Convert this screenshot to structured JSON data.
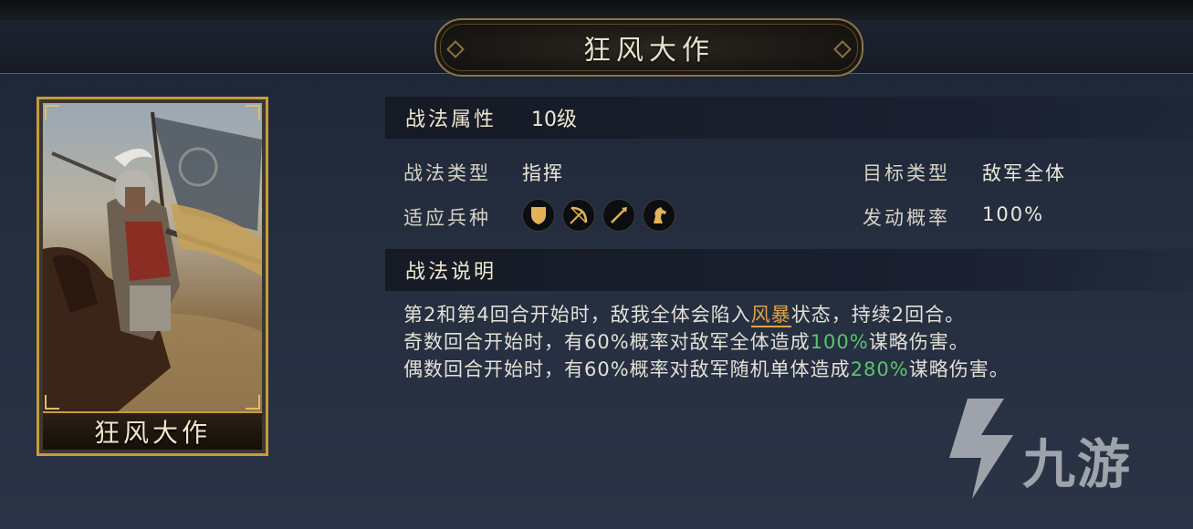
{
  "header": {
    "title": "狂风大作"
  },
  "card": {
    "name": "狂风大作"
  },
  "attributes": {
    "label": "战法属性",
    "level": "10级"
  },
  "details": {
    "type_label": "战法类型",
    "type_value": "指挥",
    "target_label": "目标类型",
    "target_value": "敌军全体",
    "troops_label": "适应兵种",
    "troop_icons": [
      "shield-icon",
      "bow-icon",
      "spear-icon",
      "horse-icon"
    ],
    "rate_label": "发动概率",
    "rate_value": "100%"
  },
  "description": {
    "label": "战法说明",
    "line1": {
      "pre": "第2和第4回合开始时，敌我全体会陷入",
      "keyword": "风暴",
      "post": "状态，持续2回合。"
    },
    "line2": {
      "pre": "奇数回合开始时，有60%概率对敌军全体造成",
      "value": "100%",
      "post": "谋略伤害。"
    },
    "line3": {
      "pre": "偶数回合开始时，有60%概率对敌军随机单体造成",
      "value": "280%",
      "post": "谋略伤害。"
    }
  },
  "watermark": {
    "text": "九游"
  },
  "colors": {
    "gold": "#c89b3c",
    "keyword": "#e2a447",
    "highlight_number": "#5bc46b"
  }
}
